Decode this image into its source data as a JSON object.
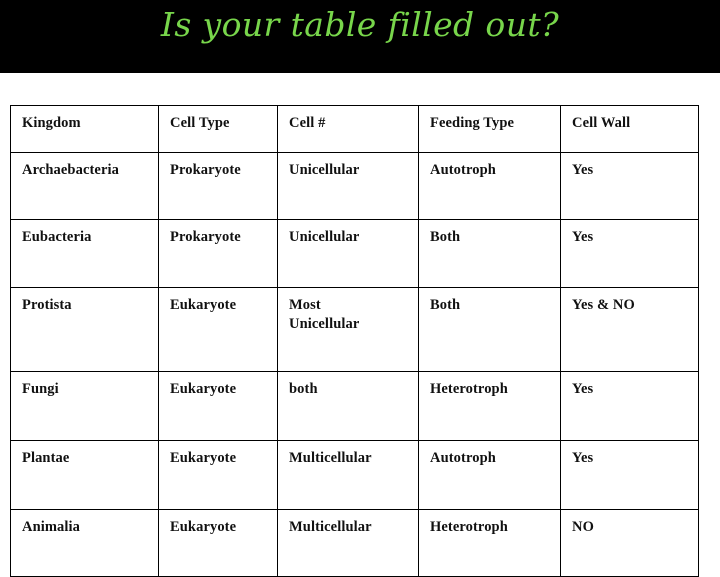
{
  "slide": {
    "title": "Is your table filled out?",
    "title_color": "#78d64b",
    "banner_color": "#000000",
    "background_color": "#ffffff"
  },
  "table": {
    "columns": [
      "Kingdom",
      "Cell Type",
      "Cell #",
      "Feeding Type",
      "Cell Wall"
    ],
    "rows": [
      {
        "kingdom": "Archaebacteria",
        "cell_type": "Prokaryote",
        "cell_number": "Unicellular",
        "feeding_type": "Autotroph",
        "cell_wall": "Yes"
      },
      {
        "kingdom": "Eubacteria",
        "cell_type": "Prokaryote",
        "cell_number": "Unicellular",
        "feeding_type": "Both",
        "cell_wall": "Yes"
      },
      {
        "kingdom": "Protista",
        "cell_type": "Eukaryote",
        "cell_number": "Most Unicellular",
        "cell_number_line1": "Most",
        "cell_number_line2": "Unicellular",
        "feeding_type": "Both",
        "cell_wall": "Yes & NO"
      },
      {
        "kingdom": "Fungi",
        "cell_type": "Eukaryote",
        "cell_number": "both",
        "feeding_type": "Heterotroph",
        "cell_wall": "Yes"
      },
      {
        "kingdom": "Plantae",
        "cell_type": "Eukaryote",
        "cell_number": "Multicellular",
        "feeding_type": "Autotroph",
        "cell_wall": "Yes"
      },
      {
        "kingdom": "Animalia",
        "cell_type": "Eukaryote",
        "cell_number": "Multicellular",
        "feeding_type": "Heterotroph",
        "cell_wall": "NO"
      }
    ]
  }
}
